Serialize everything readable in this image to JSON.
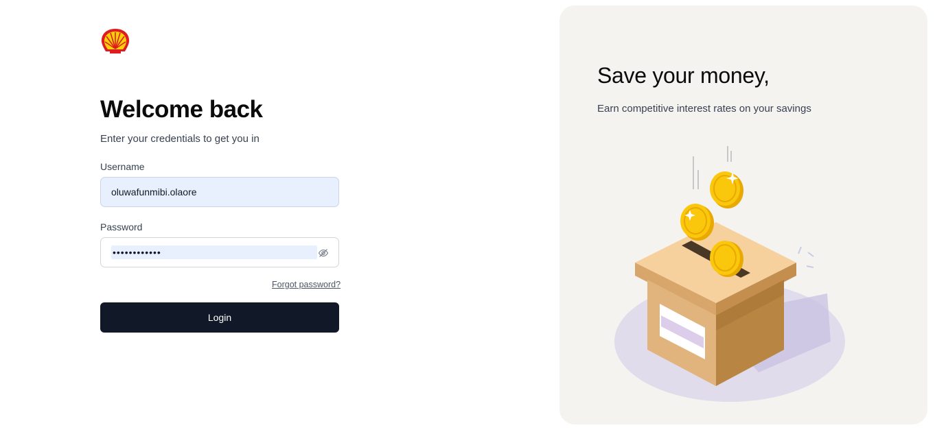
{
  "brand": {
    "logo_icon": "shell-logo-icon",
    "colors": {
      "red": "#dd1d21",
      "yellow": "#fbce07"
    }
  },
  "login": {
    "title": "Welcome back",
    "subtitle": "Enter your credentials to get you in",
    "username_label": "Username",
    "username_value": "oluwafunmibi.olaore",
    "password_label": "Password",
    "password_masked": "••••••••••••",
    "forgot_label": "Forgot password?",
    "login_label": "Login"
  },
  "panel": {
    "title": "Save your money,",
    "subtitle": "Earn competitive interest rates on your savings",
    "illustration_icon": "coin-savings-box-icon"
  }
}
